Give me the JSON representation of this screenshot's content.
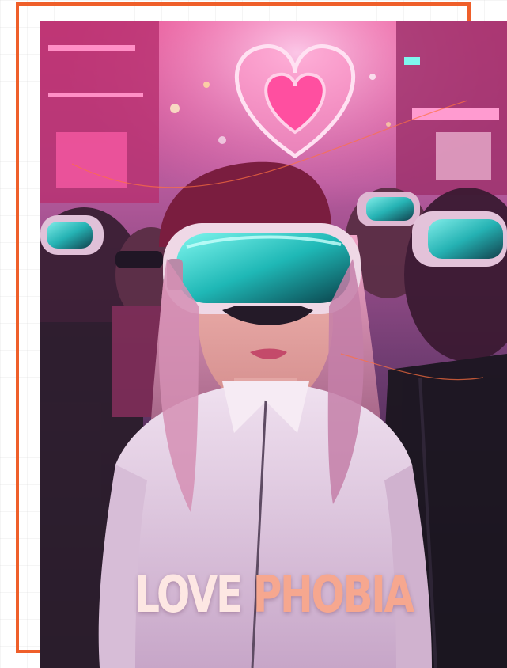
{
  "poster": {
    "title_word_1": "LOVE",
    "title_word_2": "PHOBIA"
  },
  "colors": {
    "frame": "#ef5f2a",
    "title_word_1": "#fde7e3",
    "title_word_2": "#f6a78f",
    "neon_pink": "#ff4fa0",
    "visor_cyan": "#35e6df"
  }
}
